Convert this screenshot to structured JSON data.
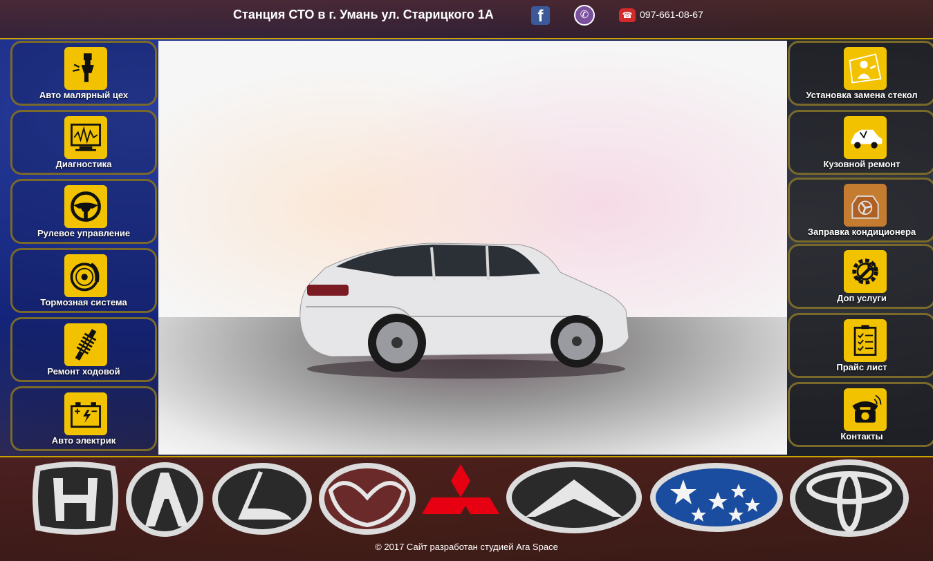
{
  "header": {
    "title": "Станция СТО в г. Умань ул. Старицкого 1А",
    "facebook_icon": "facebook-icon",
    "viber_icon": "viber-icon",
    "phone_icon": "phone-icon",
    "phone": "097-661-08-67"
  },
  "left_menu": [
    {
      "label": "Авто малярный цех",
      "icon": "spray-gun-icon"
    },
    {
      "label": "Диагностика",
      "icon": "diagnostic-monitor-icon"
    },
    {
      "label": "Рулевое управление",
      "icon": "steering-wheel-icon"
    },
    {
      "label": "Тормозная система",
      "icon": "brake-disc-icon"
    },
    {
      "label": "Ремонт ходовой",
      "icon": "shock-absorber-icon"
    },
    {
      "label": "Авто электрик",
      "icon": "car-battery-icon"
    }
  ],
  "right_menu": [
    {
      "label": "Установка замена стекол",
      "icon": "glass-installer-icon"
    },
    {
      "label": "Кузовной ремонт",
      "icon": "car-body-icon"
    },
    {
      "label": "Заправка кондиционера",
      "icon": "ac-fan-icon"
    },
    {
      "label": "Доп услуги",
      "icon": "gear-wrench-icon"
    },
    {
      "label": "Прайс лист",
      "icon": "clipboard-checklist-icon"
    },
    {
      "label": "Контакты",
      "icon": "telephone-icon"
    }
  ],
  "brands": [
    "Honda",
    "Acura",
    "Lexus",
    "Mazda",
    "Mitsubishi",
    "Infiniti",
    "Subaru",
    "Toyota"
  ],
  "footer": {
    "copyright": "© 2017 Сайт разработан студией Ara Space"
  }
}
